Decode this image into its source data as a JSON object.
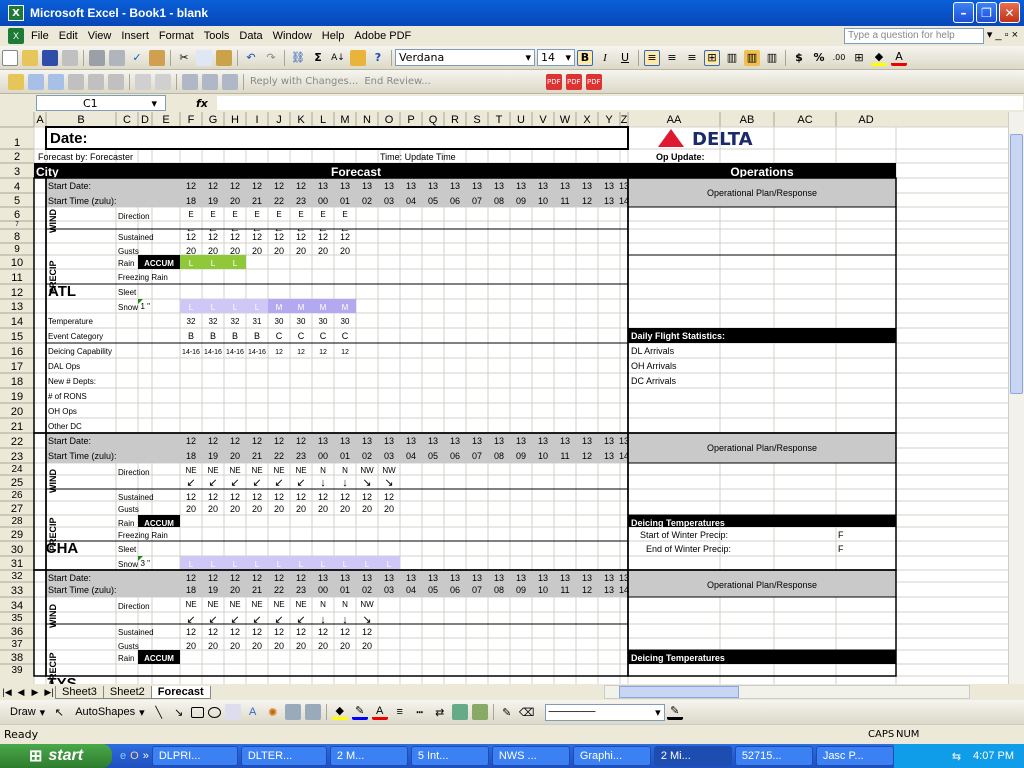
{
  "window": {
    "title": "Microsoft Excel - Book1 - blank"
  },
  "menu": [
    "File",
    "Edit",
    "View",
    "Insert",
    "Format",
    "Tools",
    "Data",
    "Window",
    "Help",
    "Adobe PDF"
  ],
  "help_placeholder": "Type a question for help",
  "toolbar": {
    "font": "Verdana",
    "size": "14",
    "reply_text": "Reply with Changes...",
    "end_review": "End Review..."
  },
  "namebox": "C1",
  "fx": "fx",
  "columns": [
    "A",
    "B",
    "C",
    "D",
    "E",
    "F",
    "G",
    "H",
    "I",
    "J",
    "K",
    "L",
    "M",
    "N",
    "O",
    "P",
    "Q",
    "R",
    "S",
    "T",
    "U",
    "V",
    "W",
    "X",
    "Y",
    "Z",
    "AA",
    "AB",
    "AC",
    "AD"
  ],
  "header": {
    "date_label": "Date:",
    "forecast_by": "Forecast by: Forecaster",
    "time": "Time: Update Time",
    "op_update": "Op Update:",
    "city": "City",
    "forecast": "Forecast",
    "operations": "Operations",
    "delta": "DELTA"
  },
  "labels": {
    "start_date": "Start Date:",
    "start_time": "Start Time (zulu):",
    "direction": "Direction",
    "sustained": "Sustained",
    "gusts": "Gusts",
    "rain": "Rain",
    "freezing_rain": "Freezing Rain",
    "sleet": "Sleet",
    "snow": "Snow",
    "temperature": "Temperature",
    "event_category": "Event Category",
    "deicing_capability": "Deicing Capability",
    "dal_ops": "DAL Ops",
    "new_depts": "New # Depts:",
    "rons": "# of RONS",
    "oh_ops": "OH Ops",
    "other_dc": "Other DC",
    "wind": "WIND",
    "precip": "PRECIP",
    "accum": "ACCUM",
    "op_plan": "Operational Plan/Response",
    "daily_flight_stats": "Daily Flight Statistics:",
    "dl_arrivals": "DL Arrivals",
    "oh_arrivals": "OH Arrivals",
    "dc_arrivals": "DC Arrivals",
    "deicing_temps": "Deicing Temperatures",
    "start_winter": "Start of Winter Precip:",
    "end_winter": "End of Winter Precip:",
    "f": "F"
  },
  "cities": [
    "ATL",
    "CHA",
    "TYS"
  ],
  "dates": [
    "12",
    "12",
    "12",
    "12",
    "12",
    "12",
    "13",
    "13",
    "13",
    "13",
    "13",
    "13",
    "13",
    "13",
    "13",
    "13",
    "13",
    "13",
    "13",
    "13",
    "13"
  ],
  "times": [
    "18",
    "19",
    "20",
    "21",
    "22",
    "23",
    "00",
    "01",
    "02",
    "03",
    "04",
    "05",
    "06",
    "07",
    "08",
    "09",
    "10",
    "11",
    "12",
    "13",
    "14"
  ],
  "atl": {
    "dir": [
      "E",
      "E",
      "E",
      "E",
      "E",
      "E",
      "E",
      "E"
    ],
    "arrow": [
      "←",
      "←",
      "←",
      "←",
      "←",
      "←",
      "←",
      "←"
    ],
    "sustained": [
      "12",
      "12",
      "12",
      "12",
      "12",
      "12",
      "12",
      "12"
    ],
    "gusts": [
      "20",
      "20",
      "20",
      "20",
      "20",
      "20",
      "20",
      "20"
    ],
    "rain": [
      "L",
      "L",
      "L"
    ],
    "snow_accum": "1 \"",
    "snow": [
      "L",
      "L",
      "L",
      "L",
      "M",
      "M",
      "M",
      "M"
    ],
    "temp": [
      "32",
      "32",
      "32",
      "31",
      "30",
      "30",
      "30",
      "30"
    ],
    "event": [
      "B",
      "B",
      "B",
      "B",
      "C",
      "C",
      "C",
      "C"
    ],
    "deicing": [
      "14-16",
      "14-16",
      "14-16",
      "14-16",
      "12",
      "12",
      "12",
      "12"
    ]
  },
  "cha": {
    "dir": [
      "NE",
      "NE",
      "NE",
      "NE",
      "NE",
      "NE",
      "N",
      "N",
      "NW",
      "NW"
    ],
    "arrow": [
      "↙",
      "↙",
      "↙",
      "↙",
      "↙",
      "↙",
      "↓",
      "↓",
      "↘",
      "↘"
    ],
    "sustained": [
      "12",
      "12",
      "12",
      "12",
      "12",
      "12",
      "12",
      "12",
      "12",
      "12"
    ],
    "gusts": [
      "20",
      "20",
      "20",
      "20",
      "20",
      "20",
      "20",
      "20",
      "20",
      "20"
    ],
    "snow_accum": "3 \"",
    "snow": [
      "L",
      "L",
      "L",
      "L",
      "L",
      "L",
      "L",
      "L",
      "L",
      "L"
    ]
  },
  "tys": {
    "dir": [
      "NE",
      "NE",
      "NE",
      "NE",
      "NE",
      "NE",
      "N",
      "N",
      "NW"
    ],
    "arrow": [
      "↙",
      "↙",
      "↙",
      "↙",
      "↙",
      "↙",
      "↓",
      "↓",
      "↘"
    ],
    "sustained": [
      "12",
      "12",
      "12",
      "12",
      "12",
      "12",
      "12",
      "12",
      "12"
    ],
    "gusts": [
      "20",
      "20",
      "20",
      "20",
      "20",
      "20",
      "20",
      "20",
      "20"
    ]
  },
  "sheets": [
    "Sheet3",
    "Sheet2",
    "Forecast"
  ],
  "draw": {
    "draw": "Draw",
    "autoshapes": "AutoShapes"
  },
  "status": {
    "ready": "Ready",
    "caps": "CAPS",
    "num": "NUM"
  },
  "taskbar": {
    "start": "start",
    "tasks": [
      "DLPRI...",
      "DLTER...",
      "2 M...",
      "5 Int...",
      "NWS ...",
      "Graphi...",
      "2 Mi...",
      "52715...",
      "Jasc P..."
    ],
    "clock": "4:07 PM"
  },
  "colors": {
    "accum_bg": "#000000",
    "rain_bg": "#8fc93a",
    "snow_bg": "#b3a9f0",
    "snow_light": "#cfc8f7",
    "gray_block": "#c9c9c9",
    "header_black": "#000000",
    "delta_red": "#e01933",
    "delta_blue": "#1b2a6b"
  }
}
